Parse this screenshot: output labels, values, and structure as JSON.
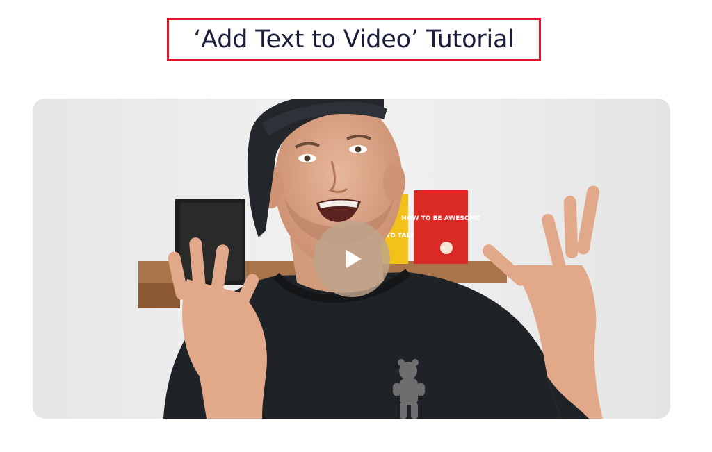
{
  "header": {
    "title": "‘Add Text to Video’ Tutorial"
  },
  "video": {
    "play_icon": "play-icon",
    "book_red_title": "HOW TO BE AWESOME",
    "book_yellow_title": "HOW TO TALK",
    "colors": {
      "title_border": "#e3102b",
      "title_text": "#1b1e3a",
      "play_button": "#bea58c"
    }
  }
}
